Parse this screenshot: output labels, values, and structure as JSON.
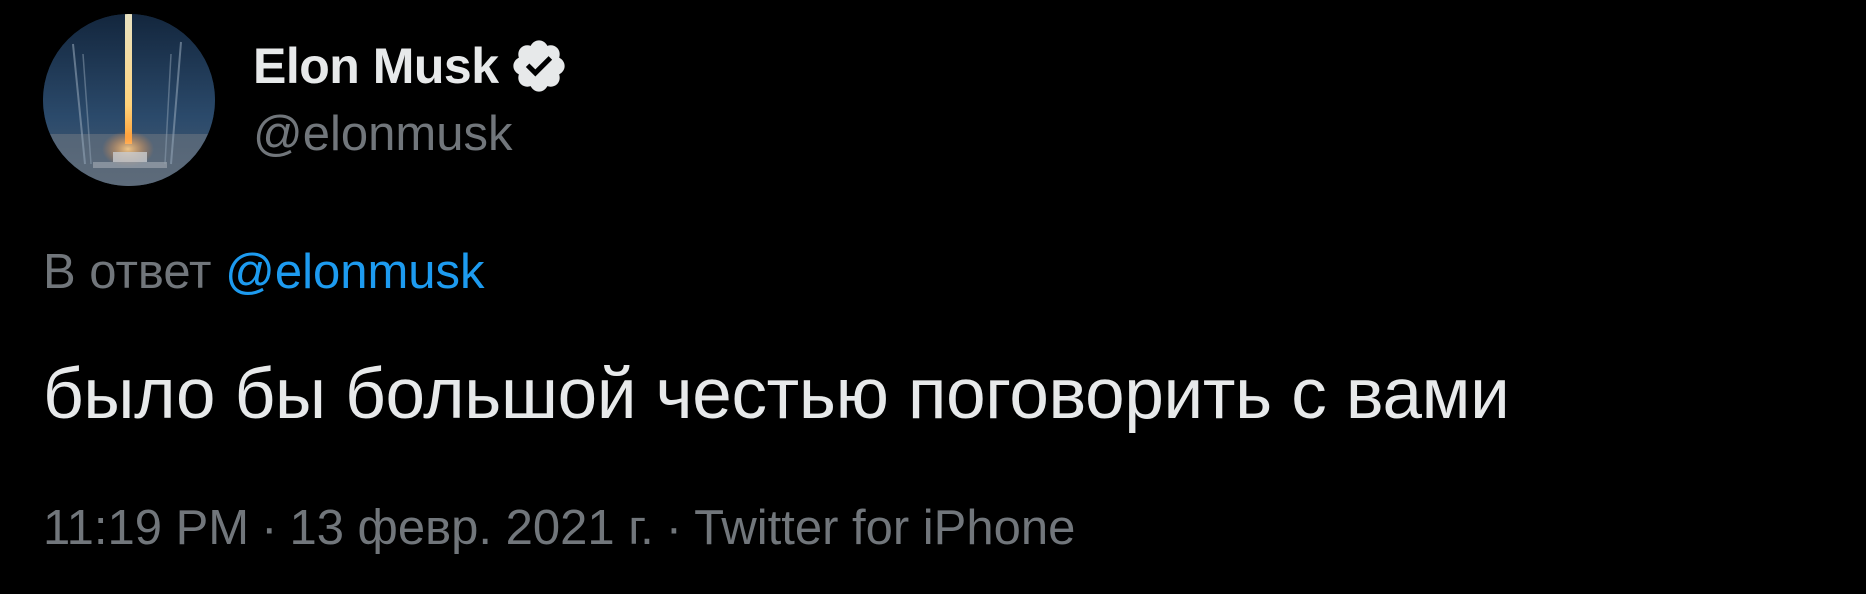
{
  "author": {
    "name": "Elon Musk",
    "handle": "@elonmusk",
    "verified": true,
    "avatar_icon": "rocket-launch-avatar"
  },
  "reply": {
    "prefix": "В ответ",
    "mention": "@elonmusk"
  },
  "tweet": {
    "text": "было бы большой честью поговорить с вами"
  },
  "meta": {
    "time": "11:19 PM",
    "separator": "·",
    "date": "13 февр. 2021 г.",
    "source": "Twitter for iPhone"
  },
  "colors": {
    "background": "#000000",
    "primary_text": "#e7e9ea",
    "secondary_text": "#71767b",
    "link": "#1d9bf0"
  }
}
